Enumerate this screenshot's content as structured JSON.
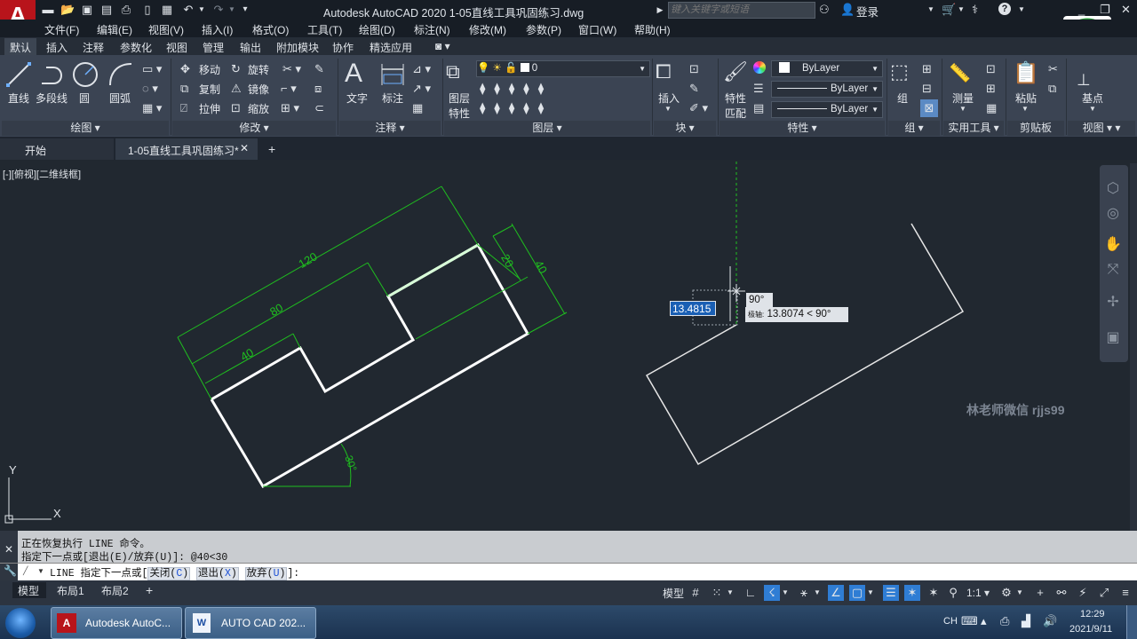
{
  "window": {
    "title": "Autodesk AutoCAD 2020    1-05直线工具巩固练习.dwg",
    "search_placeholder": "键入关键字或短语",
    "login": "登录",
    "help": "?",
    "app_logo": "A"
  },
  "menu": [
    "文件(F)",
    "编辑(E)",
    "视图(V)",
    "插入(I)",
    "格式(O)",
    "工具(T)",
    "绘图(D)",
    "标注(N)",
    "修改(M)",
    "参数(P)",
    "窗口(W)",
    "帮助(H)"
  ],
  "ribbon_tabs": [
    "默认",
    "插入",
    "注释",
    "参数化",
    "视图",
    "管理",
    "输出",
    "附加模块",
    "协作",
    "精选应用"
  ],
  "ribbon": {
    "draw": {
      "line": "直线",
      "polyline": "多段线",
      "circle": "圆",
      "arc": "圆弧",
      "title": "绘图"
    },
    "modify": {
      "move": "移动",
      "rotate": "旋转",
      "copy": "复制",
      "mirror": "镜像",
      "stretch": "拉伸",
      "scale": "缩放",
      "title": "修改"
    },
    "annotation": {
      "text": "文字",
      "dimension": "标注",
      "title": "注释"
    },
    "layers": {
      "layer_props_1": "图层",
      "layer_props_2": "特性",
      "current_layer": "0",
      "title": "图层"
    },
    "block": {
      "insert": "插入",
      "title": "块"
    },
    "properties": {
      "match_1": "特性",
      "match_2": "匹配",
      "color": "ByLayer",
      "linetype": "ByLayer",
      "lineweight": "ByLayer",
      "title": "特性"
    },
    "groups": {
      "group": "组",
      "title": "组"
    },
    "utilities": {
      "measure": "测量",
      "title": "实用工具"
    },
    "clipboard": {
      "paste": "粘贴",
      "title": "剪贴板"
    },
    "view": {
      "base": "基点",
      "title": "视图"
    }
  },
  "doc_tabs": {
    "start": "开始",
    "drawing": "1-05直线工具巩固练习*"
  },
  "canvas": {
    "viewport_label": "[-][俯视][二维线框]",
    "dims": {
      "d120": "120",
      "d80": "80",
      "d40a": "40",
      "d20": "20",
      "d40b": "40",
      "angle": "30°"
    },
    "dynamic_input": "13.4815",
    "angle_tooltip": "90°",
    "polar_prefix": "极轴:",
    "polar_tooltip": "13.8074 < 90°",
    "ucs_y": "Y",
    "ucs_x": "X",
    "watermark": "林老师微信 rjjs99"
  },
  "command": {
    "history_1": "正在恢复执行 LINE 命令。",
    "history_2": "指定下一点或[退出(E)/放弃(U)]: @40<30",
    "prompt": "LINE 指定下一点或[",
    "opt_close": "关闭(",
    "opt_close_key": "C",
    "opt_exit": "退出(",
    "opt_exit_key": "X",
    "opt_undo": "放弃(",
    "opt_undo_key": "U",
    "paren": ")",
    "end": "]:"
  },
  "layout_tabs": [
    "模型",
    "布局1",
    "布局2"
  ],
  "status": {
    "model": "模型",
    "scale": "1:1"
  },
  "taskbar": {
    "app1": "Autodesk AutoC...",
    "app2": "AUTO  CAD 202...",
    "ime": "CH",
    "time": "12:29",
    "date": "2021/9/11"
  },
  "colors": {
    "dimension": "#1fbf1f",
    "object": "#ffffff",
    "accent": "#2f7dd4"
  }
}
